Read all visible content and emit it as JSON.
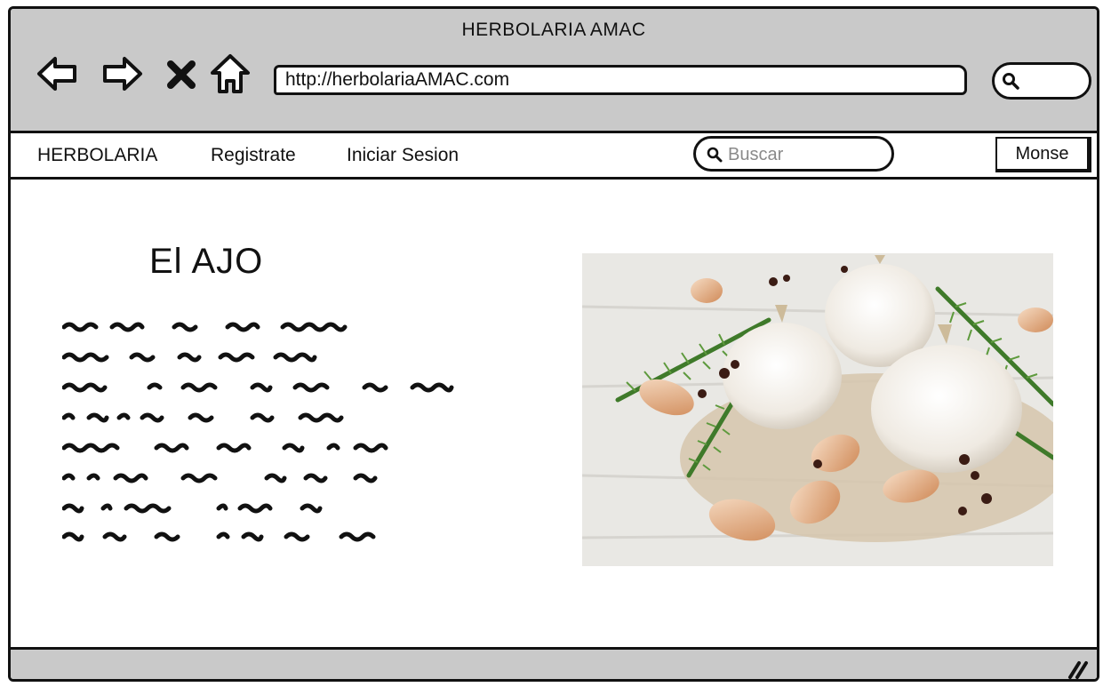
{
  "window": {
    "title": "HERBOLARIA AMAC"
  },
  "toolbar": {
    "back_icon": "arrow-left-icon",
    "forward_icon": "arrow-right-icon",
    "stop_icon": "close-icon",
    "home_icon": "home-icon",
    "url": "http://herbolariaAMAC.com",
    "search_icon": "search-icon"
  },
  "menu": {
    "items": [
      "HERBOLARIA",
      "Registrate",
      "Iniciar Sesion"
    ],
    "search_placeholder": "Buscar",
    "user_label": "Monse"
  },
  "main": {
    "title": "El AJO",
    "body_text": "placeholder scribble text (8 lines)",
    "image": "garlic-photo"
  },
  "colors": {
    "chrome_gray": "#c9c9c9",
    "ink": "#111111",
    "placeholder_gray": "#8a8a8a"
  }
}
